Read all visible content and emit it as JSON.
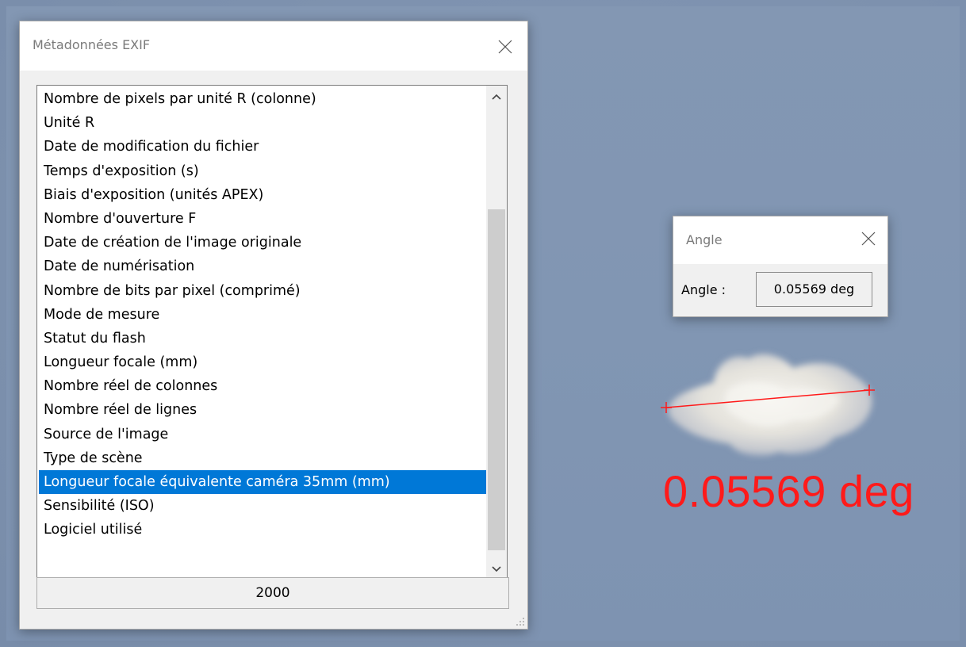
{
  "viewer": {
    "angle_overlay_text": "0.05569 deg",
    "overlay_color": "#ff1a1a"
  },
  "exif_dialog": {
    "title": "Métadonnées EXIF",
    "close_icon": "close-icon",
    "items": [
      "Nombre de pixels par unité R (colonne)",
      "Unité R",
      "Date de modification du fichier",
      "Temps d'exposition (s)",
      "Biais d'exposition (unités APEX)",
      "Nombre d'ouverture F",
      "Date de création de l'image originale",
      "Date de numérisation",
      "Nombre de bits par pixel (comprimé)",
      "Mode de mesure",
      "Statut du flash",
      "Longueur focale (mm)",
      "Nombre réel de colonnes",
      "Nombre réel de lignes",
      "Source de l'image",
      "Type de scène",
      "Longueur focale équivalente caméra 35mm (mm)",
      "Sensibilité (ISO)",
      "Logiciel utilisé"
    ],
    "selected_index": 16,
    "selected_value": "2000",
    "selection_color": "#0078d7"
  },
  "angle_dialog": {
    "title": "Angle",
    "label": "Angle :",
    "value": "0.05569 deg"
  }
}
